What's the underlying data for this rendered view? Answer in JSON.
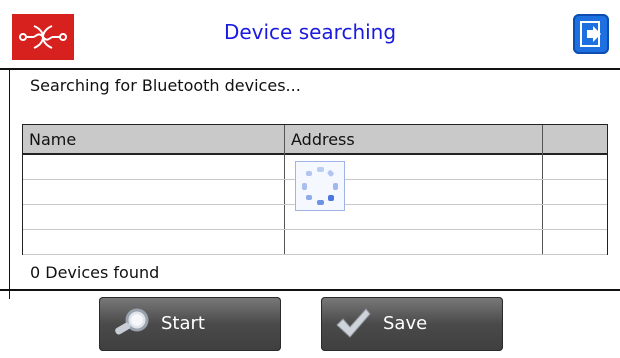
{
  "header": {
    "title": "Device searching",
    "logo_icon": "app-logo-icon",
    "exit_icon": "exit-icon"
  },
  "status": {
    "message": "Searching for Bluetooth devices..."
  },
  "table": {
    "columns": [
      "Name",
      "Address",
      ""
    ],
    "rows": [],
    "spinner_icon": "loading-spinner-icon"
  },
  "footer": {
    "found_text": "0 Devices found"
  },
  "buttons": {
    "start_label": "Start",
    "start_icon": "search-magnifier-icon",
    "save_label": "Save",
    "save_icon": "checkmark-icon"
  },
  "colors": {
    "title": "#1a1ae0",
    "logo_bg": "#d7211f",
    "exit_bg": "#1e6fe0",
    "header_bg": "#c9c9c9",
    "button_bg": "#4a4a4a"
  }
}
